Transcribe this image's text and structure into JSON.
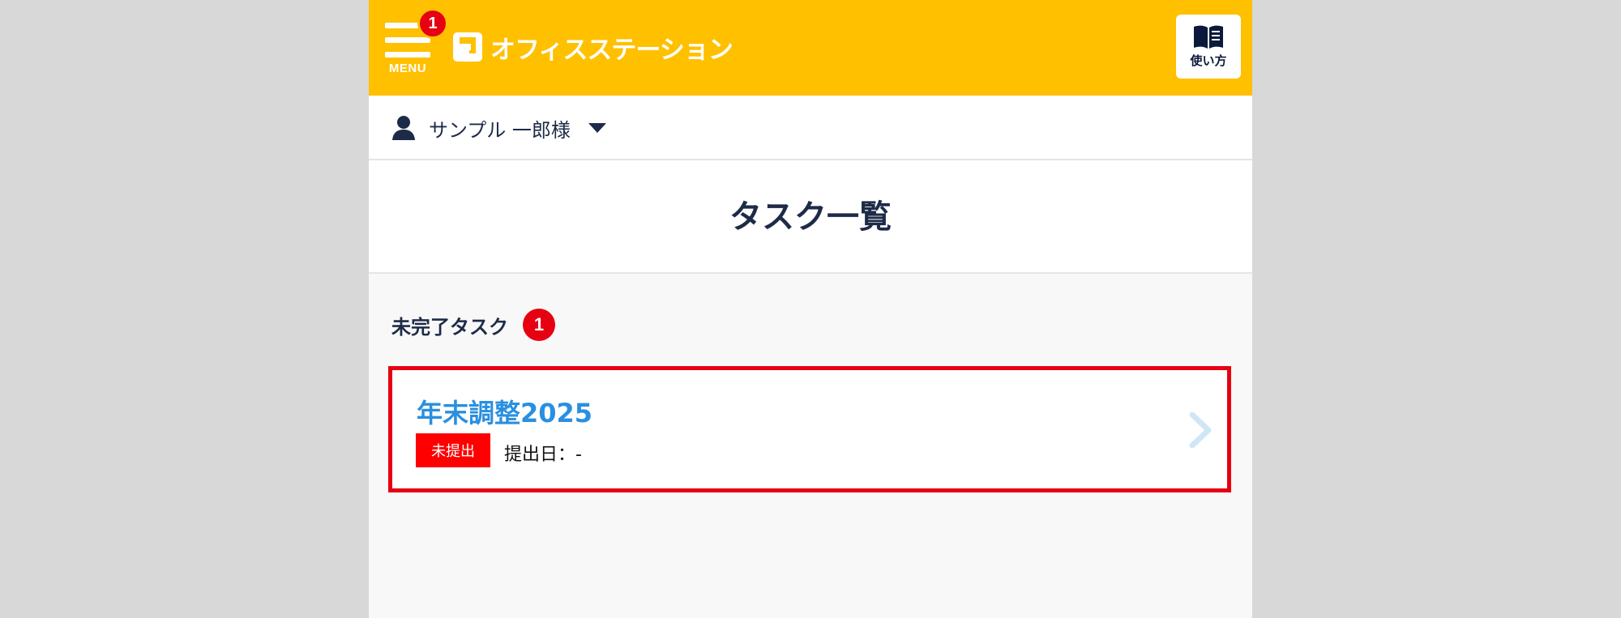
{
  "header": {
    "menu_label": "MENU",
    "menu_badge": "1",
    "brand_name": "オフィスステーション",
    "help_label": "使い方",
    "background_color": "#ffc000"
  },
  "user": {
    "name": "サンプル 一郎様",
    "icon": "person-icon",
    "dropdown_icon": "caret-down-icon"
  },
  "page": {
    "title": "タスク一覧"
  },
  "section": {
    "label": "未完了タスク",
    "count": "1"
  },
  "tasks": [
    {
      "title": "年末調整2025",
      "status": "未提出",
      "submit_date": "提出日：-",
      "status_color": "#ff0000",
      "title_color": "#2a8fe0"
    }
  ],
  "colors": {
    "accent": "#ffc000",
    "badge": "#e60012",
    "highlight_border": "#e60012",
    "text_dark": "#1d2b48"
  }
}
